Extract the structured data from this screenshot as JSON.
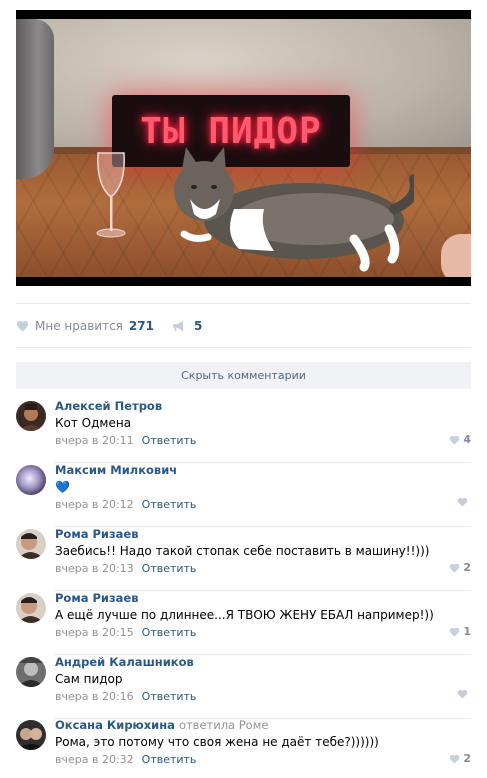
{
  "post": {
    "media": {
      "led_text": "ТЫ ПИДОР"
    },
    "likes_label": "Мне нравится",
    "likes_count": "271",
    "shares_count": "5"
  },
  "hide_comments_label": "Скрыть комментарии",
  "reply_label": "Ответить",
  "comments": [
    {
      "author": "Алексей Петров",
      "reply_to": "",
      "text": "Кот Одмена",
      "time": "вчера в 20:11",
      "likes": "4"
    },
    {
      "author": "Максим Милкович",
      "reply_to": "",
      "text": "💙",
      "time": "вчера в 20:12",
      "likes": ""
    },
    {
      "author": "Рома Ризаев",
      "reply_to": "",
      "text": "Заебись!! Надо такой стопак себе поставить в машину!!)))",
      "time": "вчера в 20:13",
      "likes": "2"
    },
    {
      "author": "Рома Ризаев",
      "reply_to": "",
      "text": "А ещё лучше по длиннее...Я ТВОЮ ЖЕНУ ЕБАЛ например!))",
      "time": "вчера в 20:15",
      "likes": "1"
    },
    {
      "author": "Андрей Калашников",
      "reply_to": "",
      "text": "Сам пидор",
      "time": "вчера в 20:16",
      "likes": ""
    },
    {
      "author": "Оксана Кирюхина",
      "reply_to": "ответила Роме",
      "text": "Рома, это потому что своя жена не даёт тебе?))))))",
      "time": "вчера в 20:32",
      "likes": "2"
    }
  ],
  "colors": {
    "link": "#2a5885",
    "muted": "#939393",
    "icon": "#c5d0db",
    "led": "#ff5a6e"
  }
}
